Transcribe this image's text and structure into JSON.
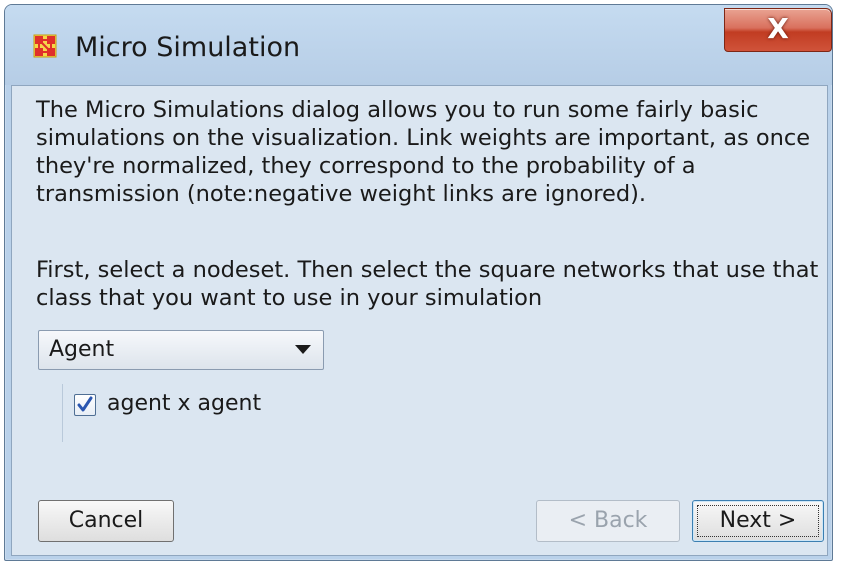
{
  "window": {
    "title": "Micro Simulation",
    "icon": "network-nodes-icon",
    "close_label": "X"
  },
  "content": {
    "description": "The Micro Simulations dialog allows you to run some fairly basic simulations on the visualization. Link weights are important, as once they're normalized, they correspond to the probability of a transmission (note:negative weight links are ignored).",
    "instructions": "First, select a nodeset. Then select the square networks that use that class that you want to use in your simulation",
    "nodeset_select": {
      "value": "Agent"
    },
    "networks": [
      {
        "label": "agent x agent",
        "checked": true
      }
    ]
  },
  "buttons": {
    "cancel": "Cancel",
    "back": "< Back",
    "next": "Next >"
  },
  "colors": {
    "window_frame": "#b9d1ea",
    "content_bg": "#dbe6f1",
    "close_button": "#c13c22",
    "checkmark": "#2a56b0",
    "icon": "#e0302a"
  }
}
